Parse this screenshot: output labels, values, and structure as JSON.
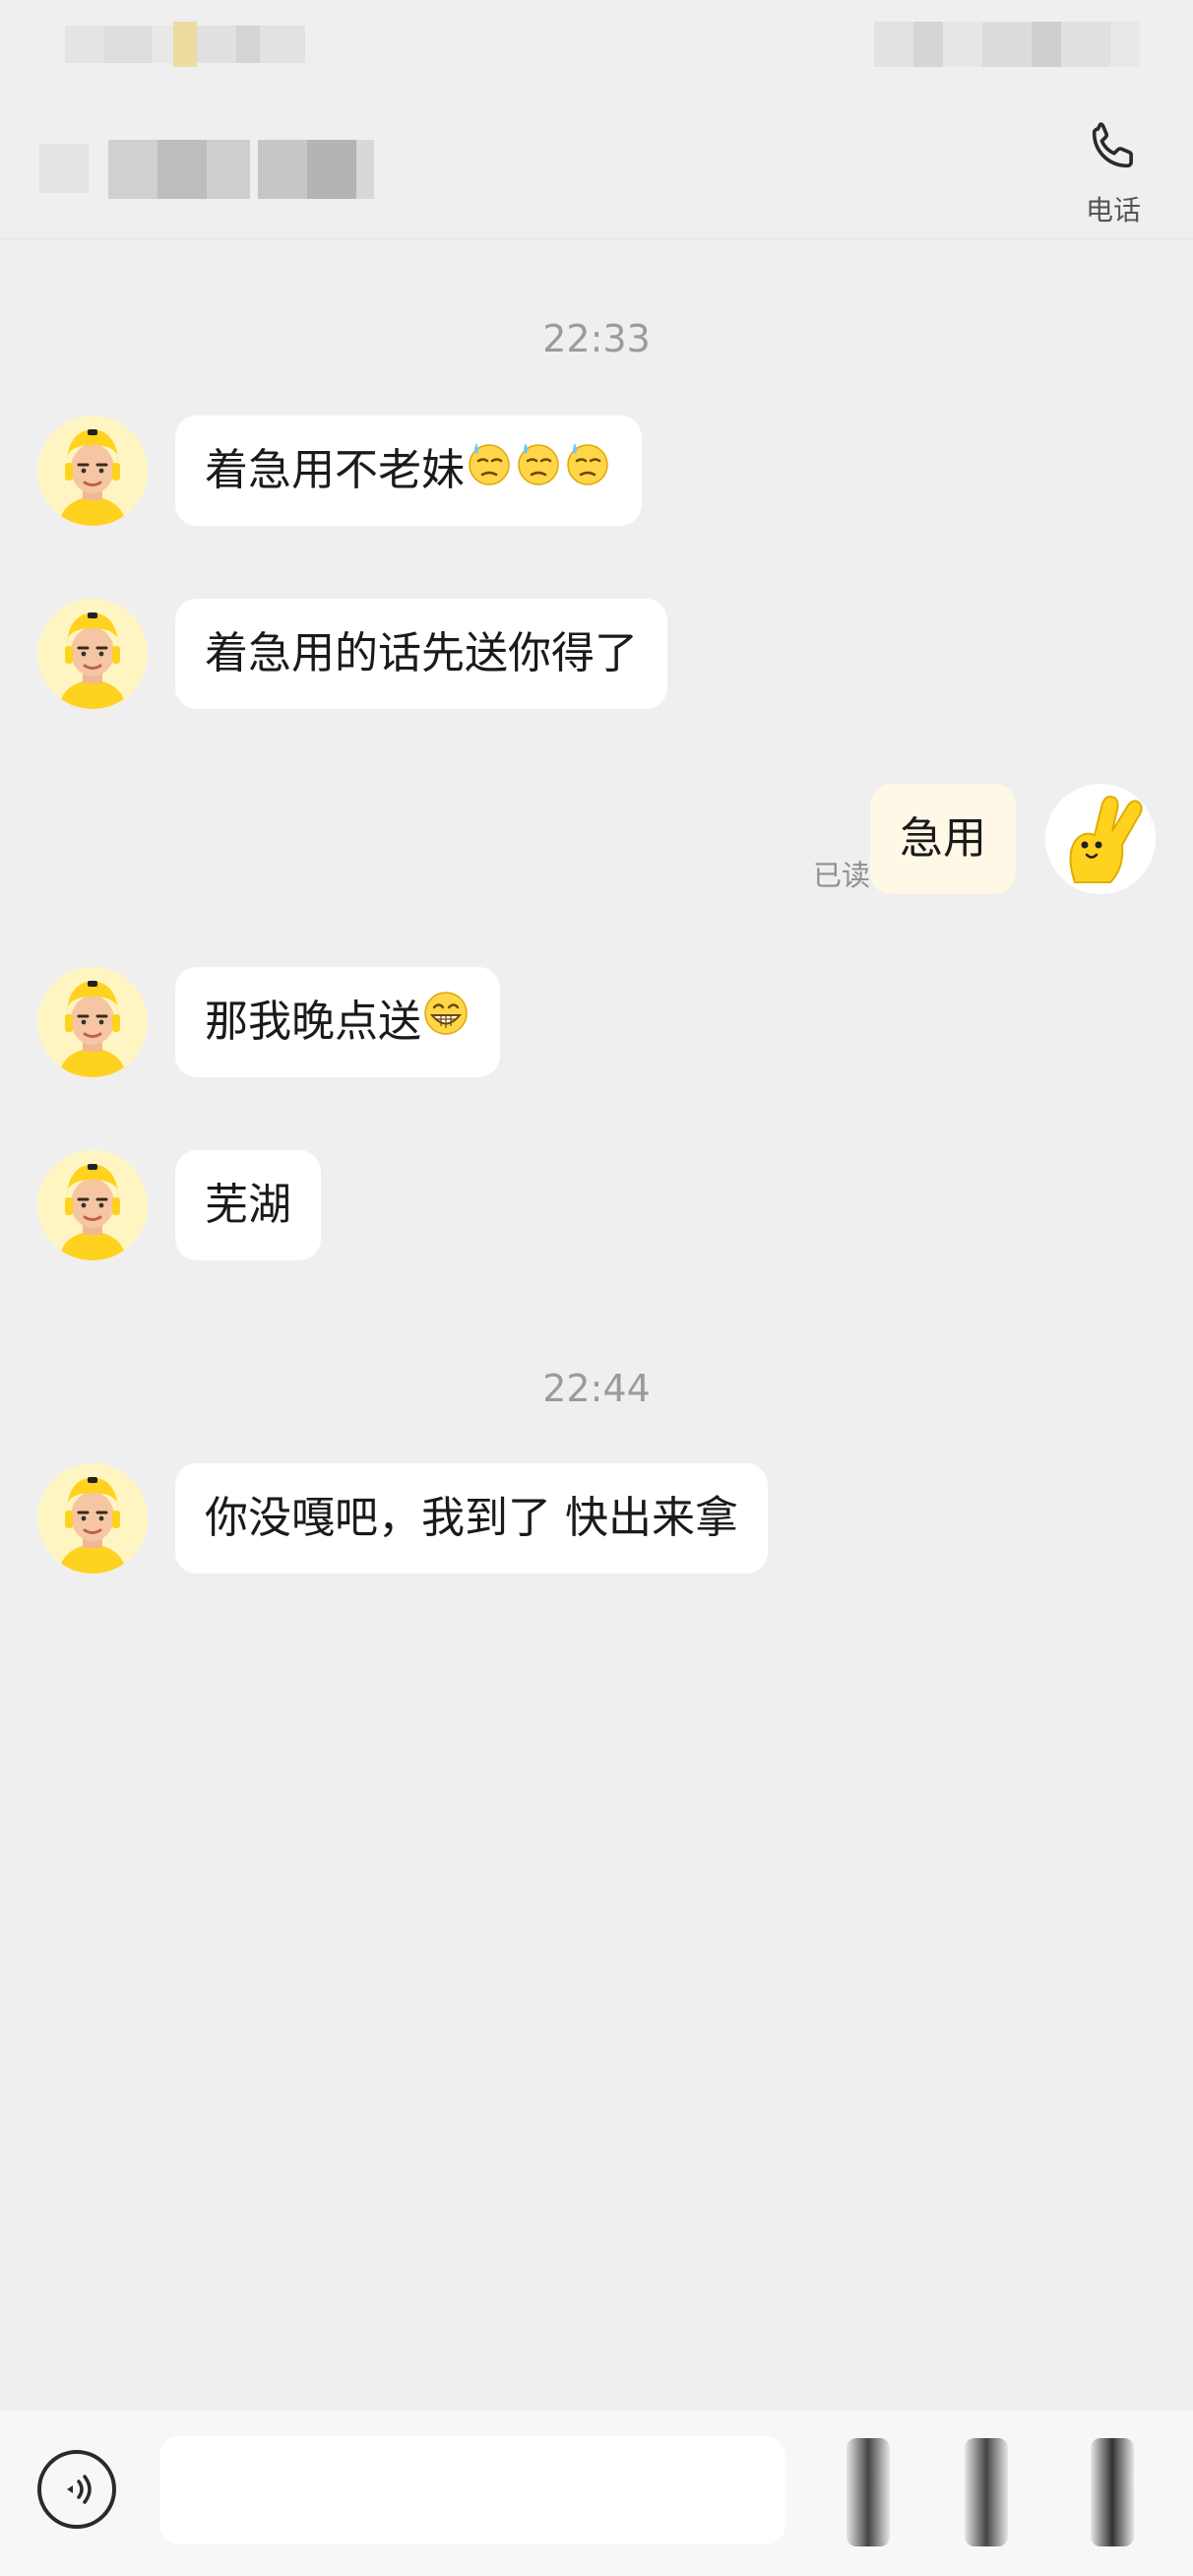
{
  "header": {
    "call_label": "电话"
  },
  "messages": [
    {
      "type": "time",
      "text": "22:33"
    },
    {
      "type": "in",
      "text": "着急用不老妹",
      "emoji": [
        "sweat-face-emoji",
        "sweat-face-emoji",
        "sweat-face-emoji"
      ]
    },
    {
      "type": "in",
      "text": "着急用的话先送你得了"
    },
    {
      "type": "out",
      "text": "急用",
      "read_status": "已读"
    },
    {
      "type": "in",
      "text": "那我晚点送",
      "emoji": [
        "grin-face-emoji"
      ]
    },
    {
      "type": "in",
      "text": "芜湖"
    },
    {
      "type": "time",
      "text": "22:44"
    },
    {
      "type": "in",
      "text": "你没嘎吧，我到了 快出来拿"
    }
  ],
  "input": {
    "value": "",
    "placeholder": ""
  },
  "icons": {
    "call": "phone-icon",
    "voice": "voice-icon",
    "incoming_avatar": "courier-avatar",
    "outgoing_avatar": "yellow-hand-avatar"
  },
  "colors": {
    "background": "#efefef",
    "incoming_bubble": "#ffffff",
    "outgoing_bubble": "#fff8e6",
    "timestamp": "#9b9b9b",
    "brand_yellow": "#ffd21f"
  }
}
